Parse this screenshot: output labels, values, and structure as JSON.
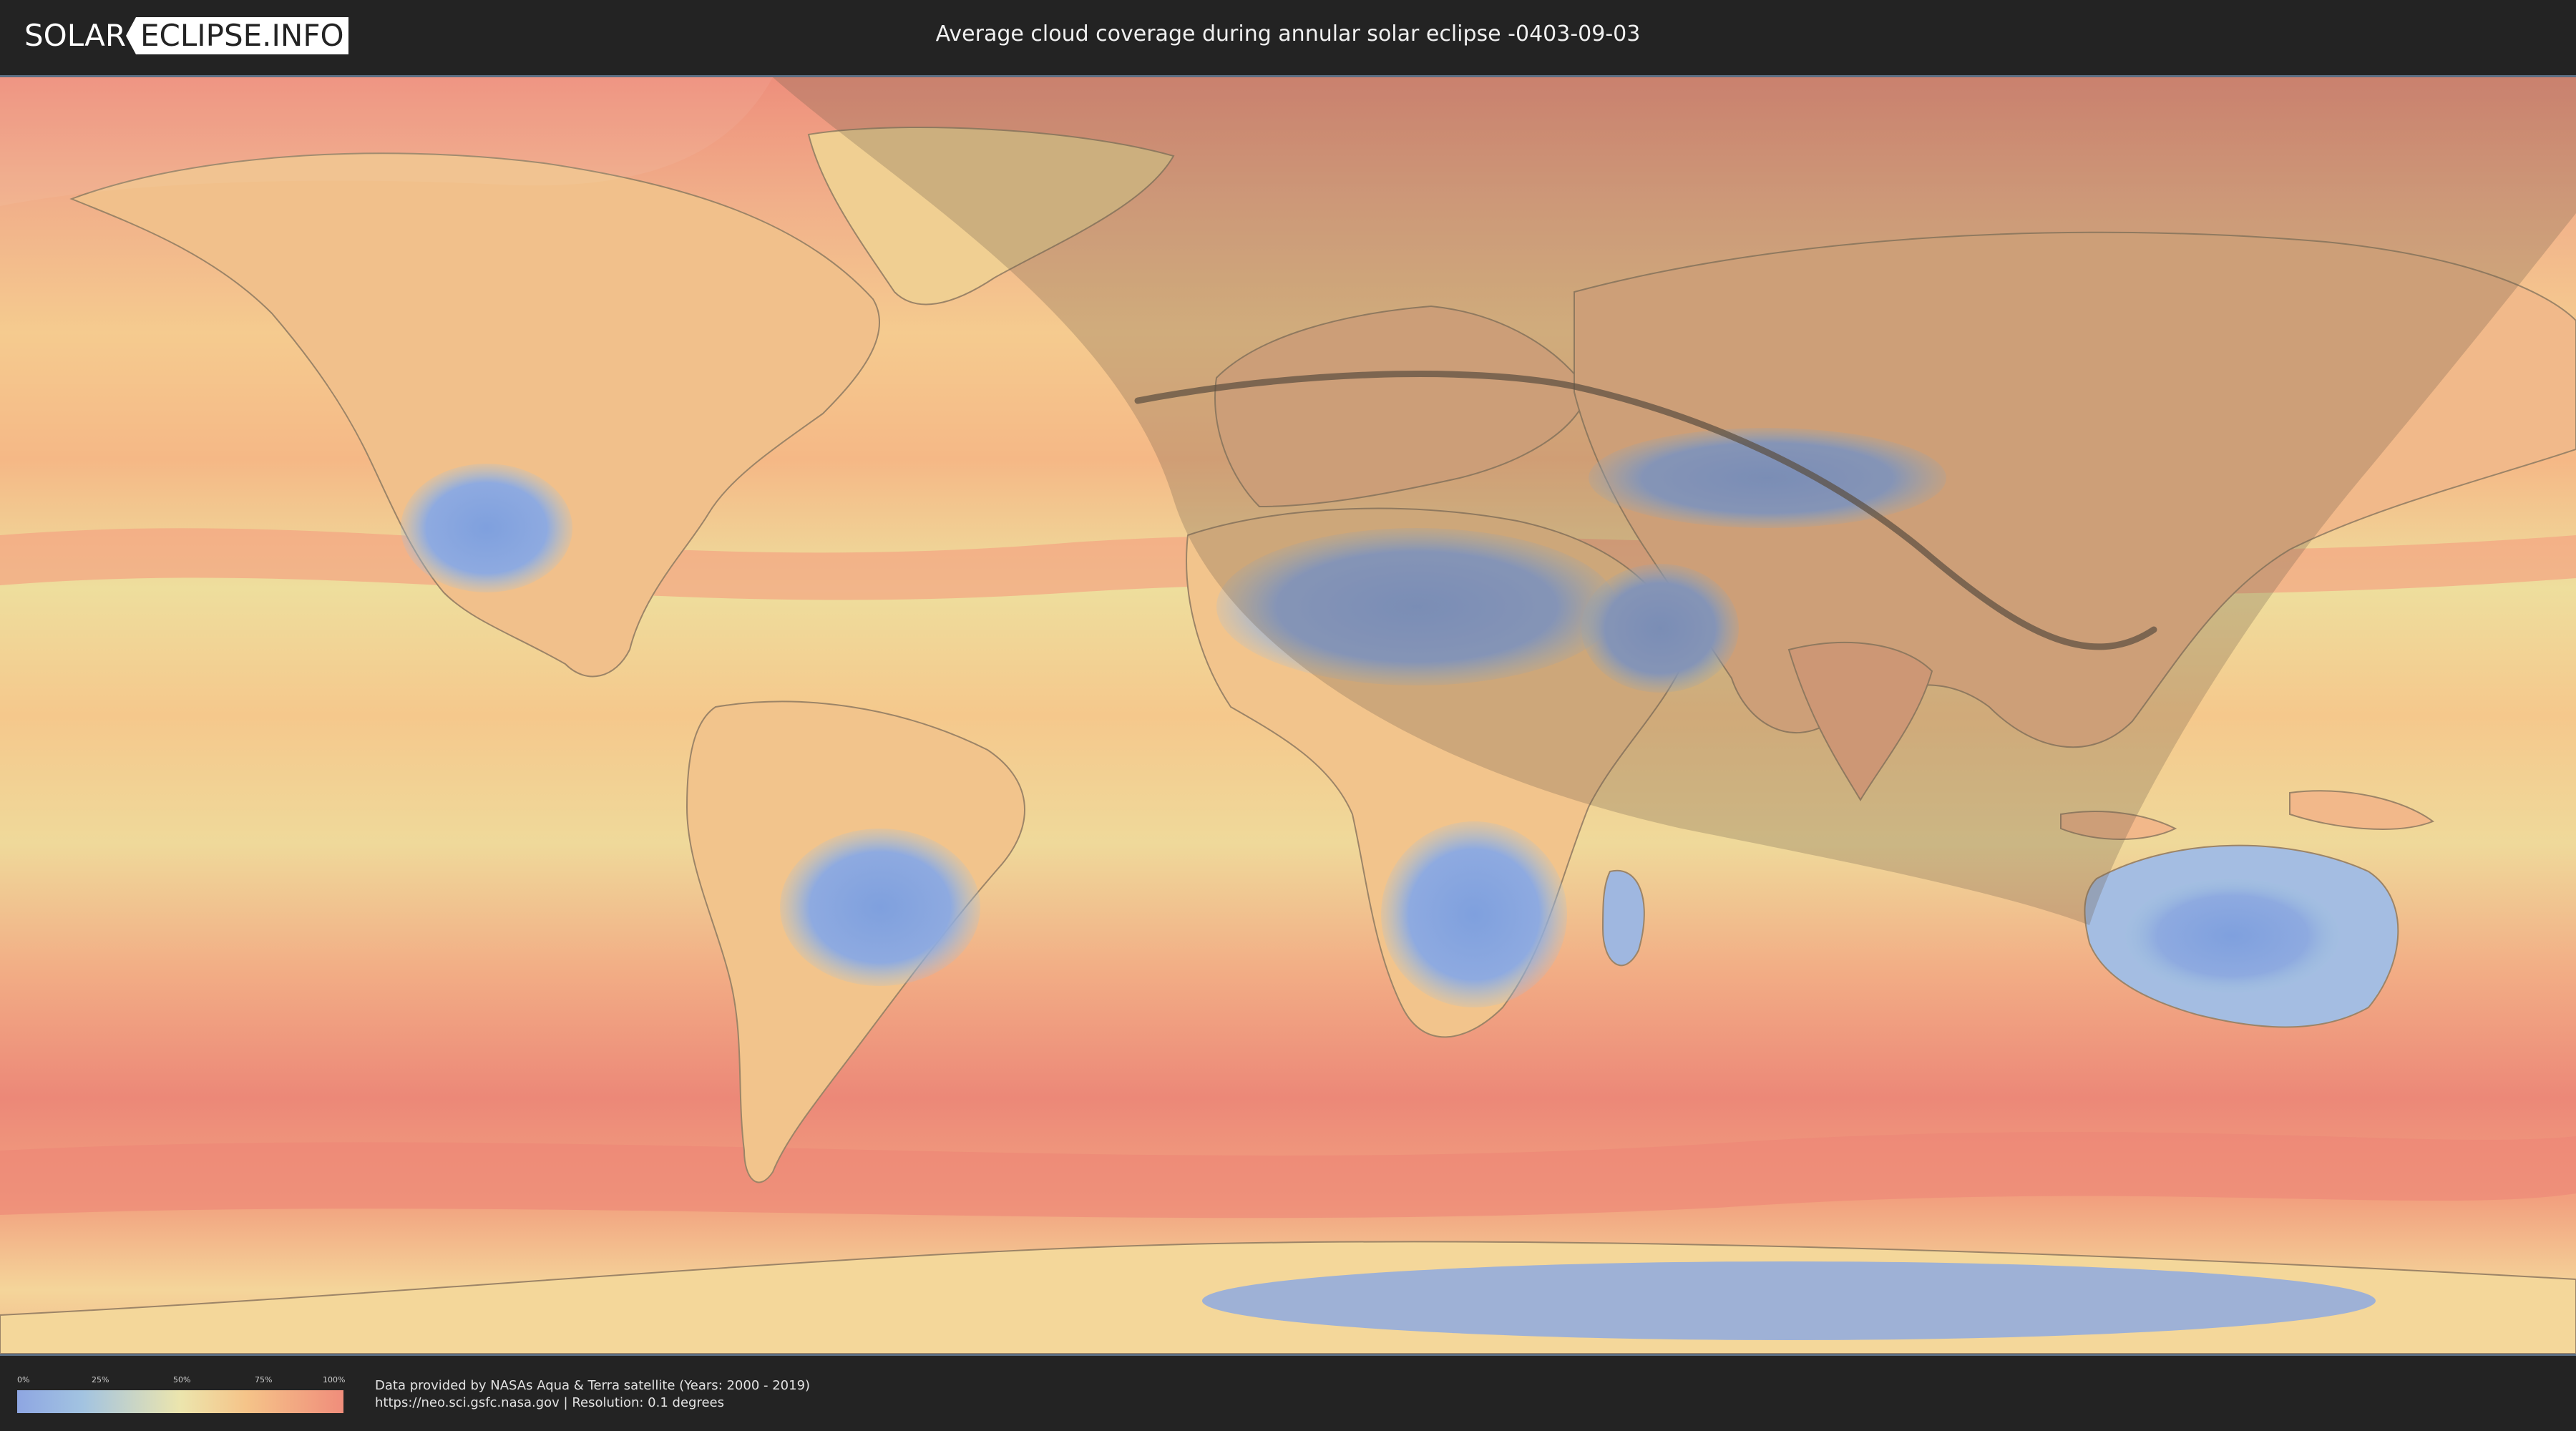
{
  "header": {
    "logo_left": "SOLAR",
    "logo_right": "ECLIPSE.INFO",
    "title": "Average cloud coverage during annular solar eclipse -0403-09-03"
  },
  "map": {
    "layer": "cloud-coverage",
    "eclipse_type": "annular",
    "eclipse_date": "-0403-09-03",
    "colors": {
      "low_cloud": "#8ea6e2",
      "mid_cloud": "#ece5ad",
      "high_cloud": "#f08d7b",
      "visibility_zone": "#6e5f4d",
      "central_path": "#5a4d3f",
      "frame": "#5c6e83"
    }
  },
  "legend": {
    "ticks": [
      "0%",
      "25%",
      "50%",
      "75%",
      "100%"
    ]
  },
  "footer": {
    "credit_line1": "Data provided by NASAs Aqua & Terra satellite (Years: 2000 - 2019)",
    "credit_line2": "https://neo.sci.gsfc.nasa.gov | Resolution: 0.1 degrees"
  }
}
